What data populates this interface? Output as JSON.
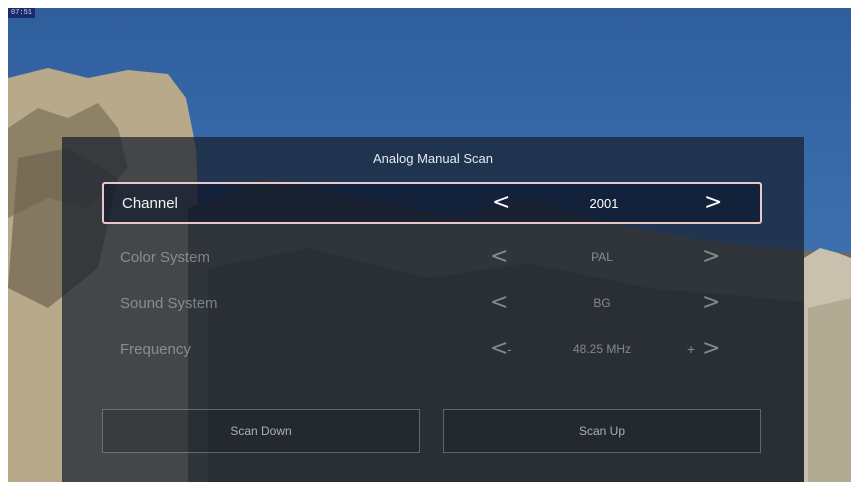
{
  "osd_label": "07:51",
  "dialog": {
    "title": "Analog Manual Scan",
    "rows": [
      {
        "label": "Channel",
        "value": "2001",
        "left": "<",
        "right": ">"
      },
      {
        "label": "Color System",
        "value": "PAL",
        "left": "<",
        "right": ">"
      },
      {
        "label": "Sound System",
        "value": "BG",
        "left": "<",
        "right": ">"
      },
      {
        "label": "Frequency",
        "value": "48.25 MHz",
        "left": "<",
        "right": ">",
        "minus": "-",
        "plus": "+"
      }
    ],
    "buttons": {
      "scan_down": "Scan Down",
      "scan_up": "Scan Up"
    }
  },
  "colors": {
    "sky": "#3a6cac",
    "panel": "#18202e",
    "focus_border": "#e7c7c7"
  }
}
